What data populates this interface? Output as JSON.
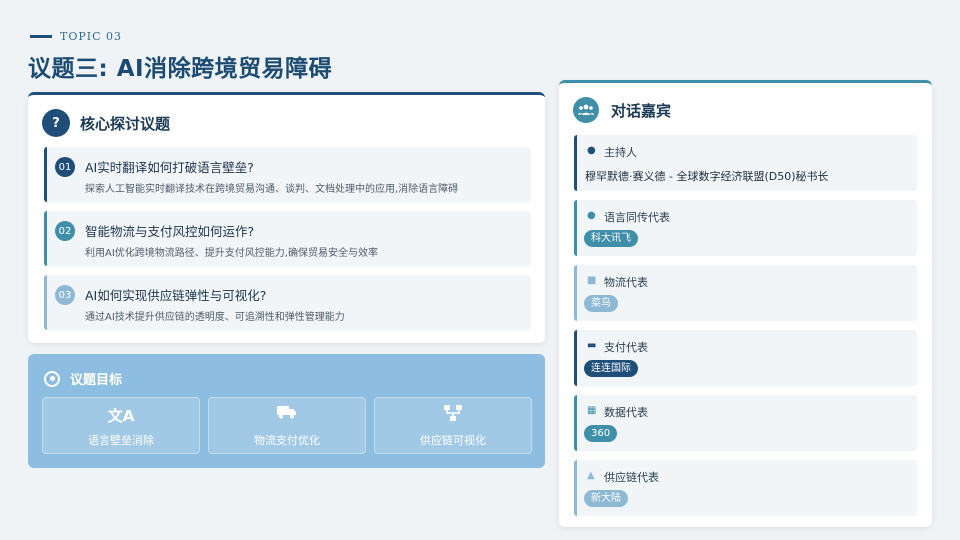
{
  "header": {
    "topic": "TOPIC 03",
    "title": "议题三: AI消除跨境贸易障碍"
  },
  "issues": {
    "title": "核心探讨议题",
    "icon": "question-icon",
    "items": [
      {
        "num": "01",
        "question": "AI实时翻译如何打破语言壁垒?",
        "desc": "探索人工智能实时翻译技术在跨境贸易沟通、谈判、文档处理中的应用,消除语言障碍"
      },
      {
        "num": "02",
        "question": "智能物流与支付风控如何运作?",
        "desc": "利用AI优化跨境物流路径、提升支付风控能力,确保贸易安全与效率"
      },
      {
        "num": "03",
        "question": "AI如何实现供应链弹性与可视化?",
        "desc": "通过AI技术提升供应链的透明度、可追溯性和弹性管理能力"
      }
    ]
  },
  "goals": {
    "title": "议题目标",
    "items": [
      {
        "icon": "translate-icon",
        "label": "语言壁垒消除"
      },
      {
        "icon": "truck-icon",
        "label": "物流支付优化"
      },
      {
        "icon": "sitemap-icon",
        "label": "供应链可视化"
      }
    ]
  },
  "guests": {
    "title": "对话嘉宾",
    "items": [
      {
        "role": "主持人",
        "icon": "user-icon",
        "name": "穆罕默德·赛义德 - 全球数字经济联盟(D50)秘书长"
      },
      {
        "role": "语言同传代表",
        "icon": "microphone-icon",
        "tag": "科大讯飞"
      },
      {
        "role": "物流代表",
        "icon": "truck-icon",
        "tag": "菜鸟"
      },
      {
        "role": "支付代表",
        "icon": "credit-card-icon",
        "tag": "连连国际"
      },
      {
        "role": "数据代表",
        "icon": "database-icon",
        "tag": "360"
      },
      {
        "role": "供应链代表",
        "icon": "sitemap-icon",
        "tag": "新大陆"
      }
    ]
  },
  "colors": {
    "navy": "#1f4e79",
    "teal": "#3f8fa8",
    "light_blue": "#8db9d4",
    "goal_bg": "#8dbde0",
    "page_bg": "#f0f3f6"
  }
}
